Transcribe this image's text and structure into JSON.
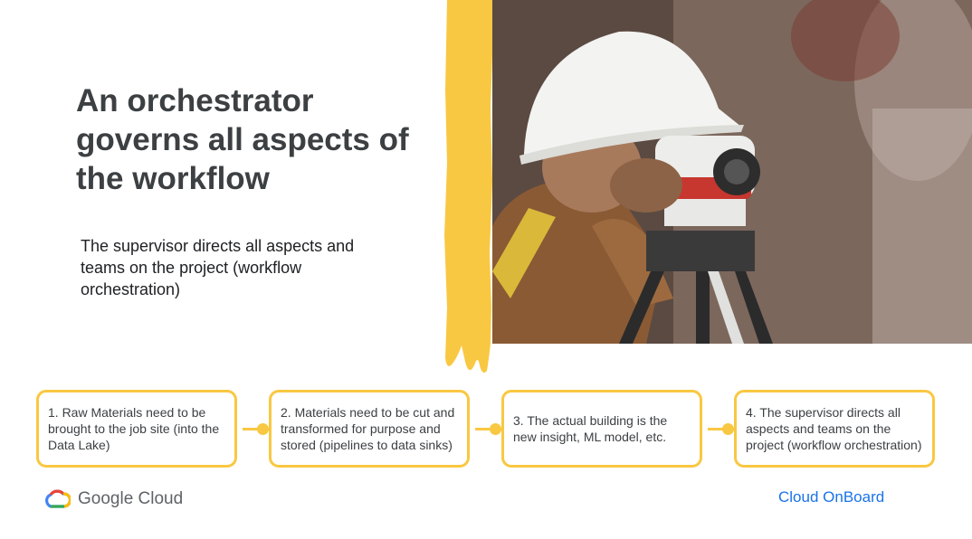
{
  "slide": {
    "title": "An orchestrator governs all aspects of the workflow",
    "subtitle": "The supervisor directs all aspects and teams on the project (workflow orchestration)"
  },
  "photo": {
    "subject": "surveyor-with-hard-hat-and-level-icon"
  },
  "steps": [
    {
      "label": "1. Raw Materials need to be brought to the job site (into the Data Lake)"
    },
    {
      "label": "2. Materials need to be cut and transformed for purpose and stored (pipelines to data sinks)"
    },
    {
      "label": "3. The actual building is the new insight, ML model, etc."
    },
    {
      "label": "4. The supervisor directs all aspects and teams on the project (workflow orchestration)"
    }
  ],
  "footer": {
    "logo_text": "Google Cloud",
    "brand_right": "Cloud OnBoard"
  },
  "colors": {
    "accent_yellow": "#f9c842",
    "title_gray": "#3c4043",
    "brand_blue": "#1a73e8"
  }
}
